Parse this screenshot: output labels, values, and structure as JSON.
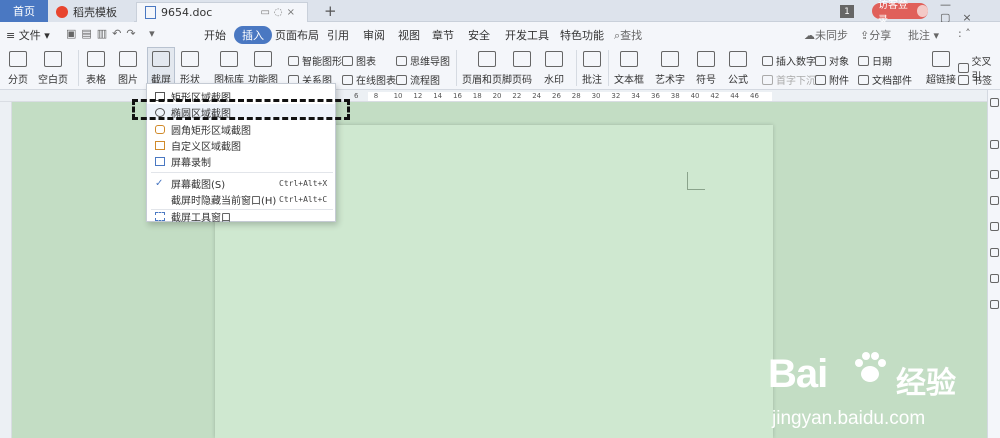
{
  "tabs": {
    "home": "首页",
    "daoke": "稻壳模板",
    "doc": "9654.doc",
    "add": "+"
  },
  "topright": {
    "badge": "1",
    "login": "访客登录",
    "help": "?",
    "more": "⋮"
  },
  "menubar": {
    "file": "≡ 文件 ▾",
    "items": [
      "开始",
      "插入",
      "页面布局",
      "引用",
      "审阅",
      "视图",
      "章节",
      "安全",
      "开发工具",
      "特色功能"
    ],
    "search": "查找",
    "sync": "未同步",
    "share": "分享",
    "annotate": "批注"
  },
  "ribbon": {
    "page_break": "分页",
    "blank_page": "空白页",
    "table": "表格",
    "picture": "图片",
    "screenshot": "截屏",
    "shape": "形状",
    "icon_lib": "图标库",
    "func_chart": "功能图",
    "smart_shape": "智能图形",
    "relation": "关系图",
    "chart": "图表",
    "online_chart": "在线图表",
    "mindmap": "思维导图",
    "flowchart": "流程图",
    "header_footer": "页眉和页脚",
    "page_num": "页码",
    "watermark": "水印",
    "comment": "批注",
    "textbox": "文本框",
    "wordart": "艺术字",
    "symbol": "符号",
    "formula": "公式",
    "insert_number": "插入数字",
    "dropcap": "首字下沉",
    "object": "对象",
    "attachment": "附件",
    "date": "日期",
    "doc_parts": "文档部件",
    "hyperlink": "超链接",
    "crossref": "交叉引",
    "bookmark": "书签"
  },
  "ruler": [
    "6",
    "8",
    "10",
    "12",
    "14",
    "16",
    "18",
    "20",
    "22",
    "24",
    "26",
    "28",
    "30",
    "32",
    "34",
    "36",
    "38",
    "40",
    "42",
    "44",
    "46"
  ],
  "dropdown": {
    "items": [
      {
        "label": "矩形区域截图",
        "shortcut": ""
      },
      {
        "label": "椭圆区域截图",
        "shortcut": ""
      },
      {
        "label": "圆角矩形区域截图",
        "shortcut": ""
      },
      {
        "label": "自定义区域截图",
        "shortcut": ""
      },
      {
        "label": "屏幕录制",
        "shortcut": ""
      },
      {
        "label": "屏幕截图(S)",
        "shortcut": "Ctrl+Alt+X"
      },
      {
        "label": "截屏时隐藏当前窗口(H)",
        "shortcut": "Ctrl+Alt+C"
      },
      {
        "label": "截屏工具窗口",
        "shortcut": ""
      }
    ]
  },
  "watermark": {
    "brand": "Bai",
    "brand_cn": "经验",
    "url": "jingyan.baidu.com"
  }
}
